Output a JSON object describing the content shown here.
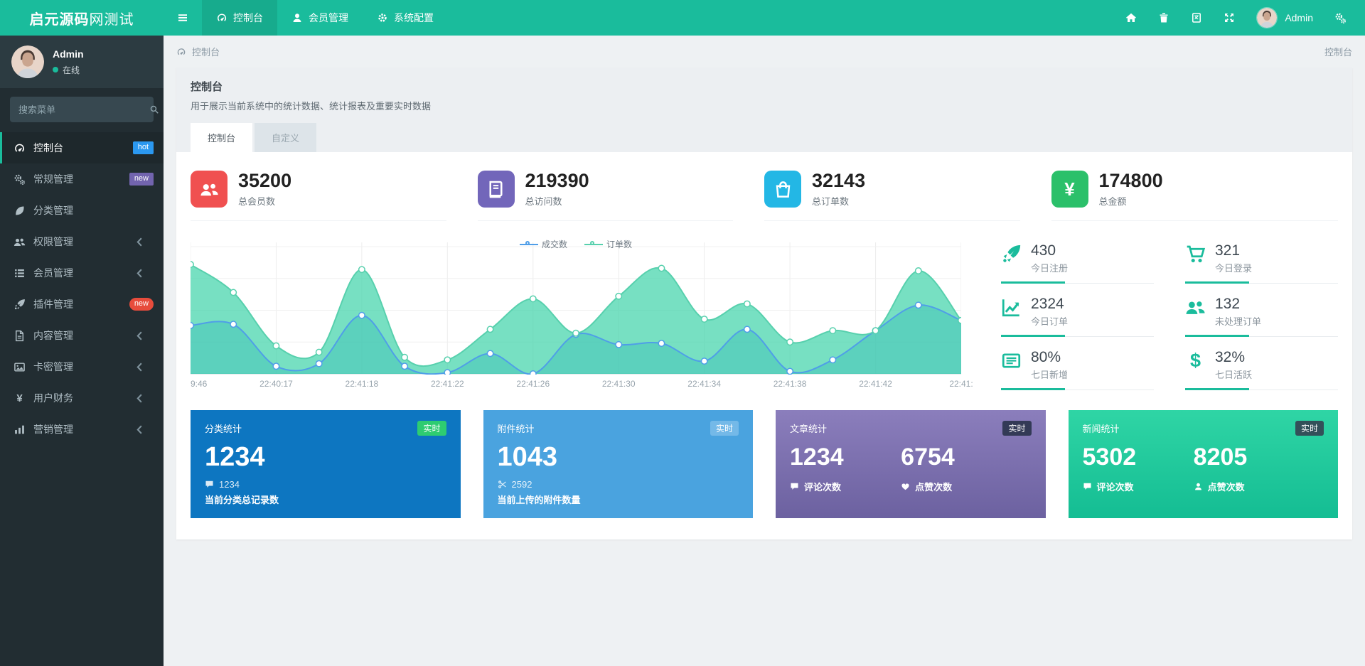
{
  "app": {
    "logo_bold": "启元源码",
    "logo_light": "网测试"
  },
  "navbar": {
    "items": [
      {
        "key": "dashboard",
        "label": "控制台",
        "icon": "gauge",
        "active": true
      },
      {
        "key": "members",
        "label": "会员管理",
        "icon": "user",
        "active": false
      },
      {
        "key": "system-config",
        "label": "系统配置",
        "icon": "gear",
        "active": false
      }
    ],
    "right_icons": [
      {
        "key": "home",
        "icon": "home"
      },
      {
        "key": "trash",
        "icon": "trash"
      },
      {
        "key": "language",
        "icon": "language"
      },
      {
        "key": "fullscreen",
        "icon": "expand"
      }
    ],
    "user": "Admin"
  },
  "sidebar": {
    "user": {
      "name": "Admin",
      "status": "在线"
    },
    "search_placeholder": "搜索菜单",
    "items": [
      {
        "key": "dashboard",
        "label": "控制台",
        "icon": "gauge",
        "active": true,
        "badge": "hot",
        "badge_color": "#2b98f0"
      },
      {
        "key": "general",
        "label": "常规管理",
        "icon": "cogs",
        "badge": "new",
        "badge_color": "#7264ae"
      },
      {
        "key": "category",
        "label": "分类管理",
        "icon": "leaf"
      },
      {
        "key": "auth",
        "label": "权限管理",
        "icon": "users",
        "chevron": true
      },
      {
        "key": "member",
        "label": "会员管理",
        "icon": "list",
        "chevron": true
      },
      {
        "key": "addon",
        "label": "插件管理",
        "icon": "rocket",
        "badge": "new",
        "badge_color": "#e74c3c",
        "badge_pill": true
      },
      {
        "key": "content",
        "label": "内容管理",
        "icon": "file",
        "chevron": true
      },
      {
        "key": "cardkey",
        "label": "卡密管理",
        "icon": "image",
        "chevron": true
      },
      {
        "key": "finance",
        "label": "用户财务",
        "icon": "yen",
        "chevron": true
      },
      {
        "key": "marketing",
        "label": "营销管理",
        "icon": "chart-bar",
        "chevron": true
      }
    ]
  },
  "breadcrumb": {
    "left": "控制台",
    "right": "控制台"
  },
  "panel": {
    "title": "控制台",
    "description": "用于展示当前系统中的统计数据、统计报表及重要实时数据",
    "tabs": [
      {
        "label": "控制台",
        "active": true
      },
      {
        "label": "自定义",
        "active": false
      }
    ]
  },
  "stats": [
    {
      "value": "35200",
      "label": "总会员数",
      "icon": "users",
      "color": "#f05050"
    },
    {
      "value": "219390",
      "label": "总访问数",
      "icon": "book",
      "color": "#7266ba"
    },
    {
      "value": "32143",
      "label": "总订单数",
      "icon": "bag",
      "color": "#23b7e5"
    },
    {
      "value": "174800",
      "label": "总金额",
      "icon": "yen",
      "color": "#2bc06a"
    }
  ],
  "chart_data": {
    "type": "area",
    "title": "",
    "smooth": true,
    "grid": true,
    "legend_position": "top-center",
    "ylim": [
      0,
      100
    ],
    "x_labels": [
      "9:46",
      "22:40:17",
      "22:41:18",
      "22:41:22",
      "22:41:26",
      "22:41:30",
      "22:41:34",
      "22:41:38",
      "22:41:42",
      "22:41:"
    ],
    "label_point_interval": 2,
    "series": [
      {
        "name": "成交数",
        "color": "#4f9ee8",
        "fill": "rgba(77,151,222,0.5)",
        "values": [
          38,
          39,
          6,
          8,
          46,
          6,
          1,
          16,
          0,
          31,
          23,
          24,
          10,
          35,
          2,
          11,
          34,
          54,
          42
        ]
      },
      {
        "name": "订单数",
        "color": "#57d0ad",
        "fill": "rgba(61,211,168,0.7)",
        "values": [
          86,
          64,
          22,
          17,
          82,
          13,
          11,
          35,
          59,
          32,
          61,
          83,
          43,
          55,
          25,
          34,
          34,
          81,
          42
        ]
      }
    ]
  },
  "mini_stats": [
    {
      "value": "430",
      "label": "今日注册",
      "icon": "rocket"
    },
    {
      "value": "321",
      "label": "今日登录",
      "icon": "cart"
    },
    {
      "value": "2324",
      "label": "今日订单",
      "icon": "chart-line"
    },
    {
      "value": "132",
      "label": "未处理订单",
      "icon": "users"
    },
    {
      "value": "80%",
      "label": "七日新增",
      "icon": "newspaper"
    },
    {
      "value": "32%",
      "label": "七日活跃",
      "icon": "dollar"
    }
  ],
  "cards": [
    {
      "key": "category-stats",
      "title": "分类统计",
      "badge": "实时",
      "badge_bg": "#2ecc71",
      "bg": "#0d76c1",
      "value": "1234",
      "sub_icon": "comment",
      "sub_value": "1234",
      "label": "当前分类总记录数"
    },
    {
      "key": "attachment-stats",
      "title": "附件统计",
      "badge": "实时",
      "badge_bg": "#74b9e8",
      "bg": "#4aa3df",
      "value": "1043",
      "sub_icon": "cut",
      "sub_value": "2592",
      "label": "当前上传的附件数量"
    },
    {
      "key": "article-stats",
      "title": "文章统计",
      "badge": "实时",
      "badge_bg": "#333a56",
      "bg": "linear-gradient(180deg,#8b7ebc,#6c61a0)",
      "cols": [
        {
          "value": "1234",
          "icon": "comment",
          "label": "评论次数"
        },
        {
          "value": "6754",
          "icon": "heart",
          "label": "点赞次数"
        }
      ]
    },
    {
      "key": "news-stats",
      "title": "新闻统计",
      "badge": "实时",
      "badge_bg": "#335059",
      "bg": "linear-gradient(180deg,#2fd5a5,#14bd93)",
      "cols": [
        {
          "value": "5302",
          "icon": "comment",
          "label": "评论次数"
        },
        {
          "value": "8205",
          "icon": "person",
          "label": "点赞次数"
        }
      ]
    }
  ]
}
